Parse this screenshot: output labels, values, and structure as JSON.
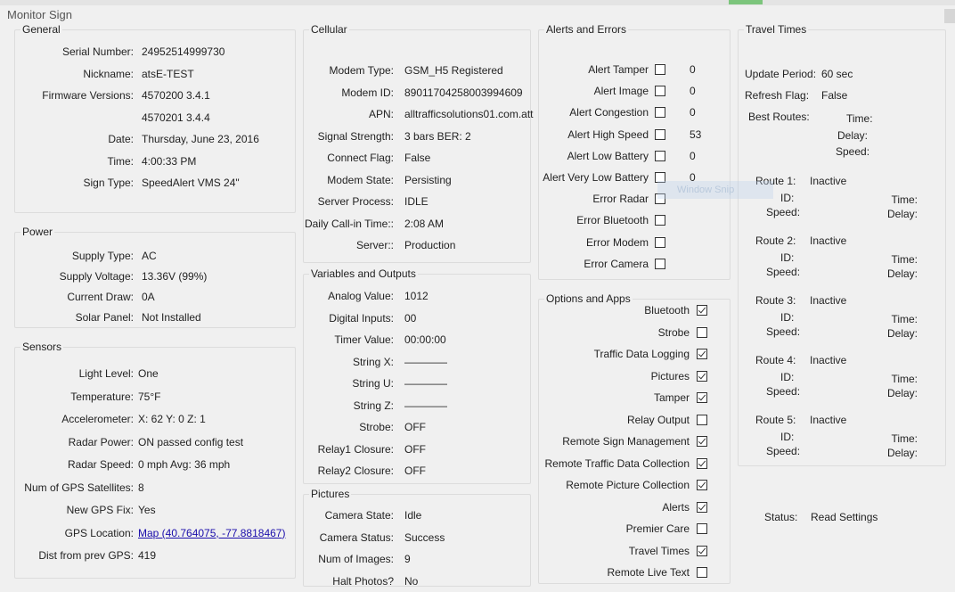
{
  "window": {
    "title": "Monitor Sign"
  },
  "general": {
    "title": "General",
    "rows": [
      {
        "label": "Serial Number:",
        "value": "24952514999730"
      },
      {
        "label": "Nickname:",
        "value": "atsE-TEST"
      },
      {
        "label": "Firmware Versions:",
        "value": "4570200 3.4.1"
      },
      {
        "label": "",
        "value": "4570201 3.4.4"
      },
      {
        "label": "Date:",
        "value": "Thursday, June 23, 2016"
      },
      {
        "label": "Time:",
        "value": "4:00:33 PM"
      },
      {
        "label": "Sign Type:",
        "value": "SpeedAlert VMS 24\""
      }
    ]
  },
  "power": {
    "title": "Power",
    "rows": [
      {
        "label": "Supply Type:",
        "value": "AC"
      },
      {
        "label": "Supply Voltage:",
        "value": "13.36V (99%)"
      },
      {
        "label": "Current Draw:",
        "value": "0A"
      },
      {
        "label": "Solar Panel:",
        "value": "Not Installed"
      }
    ]
  },
  "sensors": {
    "title": "Sensors",
    "rows": [
      {
        "label": "Light Level:",
        "value": "One"
      },
      {
        "label": "Temperature:",
        "value": "75°F"
      },
      {
        "label": "Accelerometer:",
        "value": "X: 62   Y: 0    Z: 1"
      },
      {
        "label": "Radar Power:",
        "value": "ON  passed config test"
      },
      {
        "label": "Radar Speed:",
        "value": "0 mph       Avg:   36 mph"
      },
      {
        "label": "Num of GPS Satellites:",
        "value": "8"
      },
      {
        "label": "New GPS Fix:",
        "value": "Yes"
      },
      {
        "label": "GPS Location:",
        "value": "Map (40.764075, -77.8818467)"
      },
      {
        "label": "Dist from prev GPS:",
        "value": "419"
      }
    ]
  },
  "cellular": {
    "title": "Cellular",
    "rows": [
      {
        "label": "Modem Type:",
        "value": "GSM_H5 Registered"
      },
      {
        "label": "Modem ID:",
        "value": "89011704258003994609"
      },
      {
        "label": "APN:",
        "value": "alltrafficsolutions01.com.att"
      },
      {
        "label": "Signal Strength:",
        "value": "3 bars BER: 2"
      },
      {
        "label": "Connect Flag:",
        "value": "False"
      },
      {
        "label": "Modem State:",
        "value": "Persisting"
      },
      {
        "label": "Server Process:",
        "value": "IDLE"
      },
      {
        "label": "Daily Call-in Time::",
        "value": "2:08 AM"
      },
      {
        "label": "Server::",
        "value": "Production"
      }
    ]
  },
  "variables": {
    "title": "Variables and Outputs",
    "rows": [
      {
        "label": "Analog Value:",
        "value": "1012"
      },
      {
        "label": "Digital Inputs:",
        "value": "00"
      },
      {
        "label": "Timer Value:",
        "value": "00:00:00"
      },
      {
        "label": "String X:",
        "value": "————"
      },
      {
        "label": "String U:",
        "value": "————"
      },
      {
        "label": "String Z:",
        "value": "————"
      },
      {
        "label": "Strobe:",
        "value": "OFF"
      },
      {
        "label": "Relay1 Closure:",
        "value": "OFF"
      },
      {
        "label": "Relay2 Closure:",
        "value": "OFF"
      }
    ]
  },
  "pictures": {
    "title": "Pictures",
    "rows": [
      {
        "label": "Camera State:",
        "value": "Idle"
      },
      {
        "label": "Camera Status:",
        "value": "Success"
      },
      {
        "label": "Num of Images:",
        "value": "9"
      },
      {
        "label": "Halt Photos?",
        "value": "No"
      }
    ]
  },
  "alerts": {
    "title": "Alerts and Errors",
    "rows": [
      {
        "label": "Alert Tamper",
        "checked": false,
        "count": "0"
      },
      {
        "label": "Alert Image",
        "checked": false,
        "count": "0"
      },
      {
        "label": "Alert Congestion",
        "checked": false,
        "count": "0"
      },
      {
        "label": "Alert High Speed",
        "checked": false,
        "count": "53"
      },
      {
        "label": "Alert Low Battery",
        "checked": false,
        "count": "0"
      },
      {
        "label": "Alert Very Low Battery",
        "checked": false,
        "count": "0"
      },
      {
        "label": "Error Radar",
        "checked": false,
        "count": ""
      },
      {
        "label": "Error Bluetooth",
        "checked": false,
        "count": ""
      },
      {
        "label": "Error Modem",
        "checked": false,
        "count": ""
      },
      {
        "label": "Error Camera",
        "checked": false,
        "count": ""
      }
    ]
  },
  "options": {
    "title": "Options and Apps",
    "items": [
      {
        "label": "Bluetooth",
        "checked": true
      },
      {
        "label": "Strobe",
        "checked": false
      },
      {
        "label": "Traffic Data Logging",
        "checked": true
      },
      {
        "label": "Pictures",
        "checked": true
      },
      {
        "label": "Tamper",
        "checked": true
      },
      {
        "label": "Relay Output",
        "checked": false
      },
      {
        "label": "Remote Sign Management",
        "checked": true
      },
      {
        "label": "Remote Traffic Data Collection",
        "checked": true
      },
      {
        "label": "Remote Picture Collection",
        "checked": true
      },
      {
        "label": "Alerts",
        "checked": true
      },
      {
        "label": "Premier Care",
        "checked": false
      },
      {
        "label": "Travel Times",
        "checked": true
      },
      {
        "label": "Remote Live Text",
        "checked": false
      }
    ]
  },
  "travel": {
    "title": "Travel Times",
    "update_label": "Update Period:",
    "update_value": "60 sec",
    "refresh_label": "Refresh Flag:",
    "refresh_value": "False",
    "best_label": "Best Routes:",
    "best_time": "Time:",
    "best_delay": "Delay:",
    "best_speed": "Speed:",
    "routes": [
      {
        "name": "Route 1:",
        "state": "Inactive",
        "id": "ID:",
        "time": "Time:",
        "speed": "Speed:",
        "delay": "Delay:"
      },
      {
        "name": "Route 2:",
        "state": "Inactive",
        "id": "ID:",
        "time": "Time:",
        "speed": "Speed:",
        "delay": "Delay:"
      },
      {
        "name": "Route 3:",
        "state": "Inactive",
        "id": "ID:",
        "time": "Time:",
        "speed": "Speed:",
        "delay": "Delay:"
      },
      {
        "name": "Route 4:",
        "state": "Inactive",
        "id": "ID:",
        "time": "Time:",
        "speed": "Speed:",
        "delay": "Delay:"
      },
      {
        "name": "Route 5:",
        "state": "Inactive",
        "id": "ID:",
        "time": "Time:",
        "speed": "Speed:",
        "delay": "Delay:"
      }
    ]
  },
  "status": {
    "label": "Status:",
    "value": "Read Settings"
  },
  "overlay": {
    "ghost_text": "Window Snip"
  }
}
